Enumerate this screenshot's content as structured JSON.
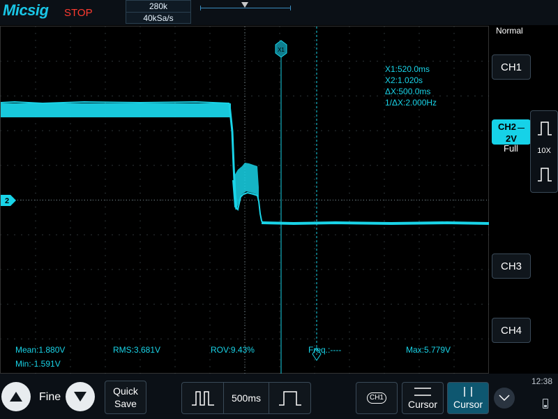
{
  "header": {
    "logo": "Micsig",
    "run_status": "STOP",
    "memory_depth": "280k",
    "sample_rate": "40kSa/s"
  },
  "cursor_readout": {
    "cursor1": "X1:520.0ms",
    "cursor2": "X2:1.020s",
    "delta": "ΔX:500.0ms",
    "inverse_delta": "1/ΔX:2.000Hz",
    "x1_tag": "X1"
  },
  "measurements": {
    "mean": "Mean:1.880V",
    "rms": "RMS:3.681V",
    "rov": "ROV:9.43%",
    "freq": "Freq.:----",
    "max": "Max:5.779V",
    "min": "Min:-1.591V"
  },
  "channel_marker": "2",
  "right_panel": {
    "trigger_mode": "Normal",
    "ch1": "CH1",
    "ch2": "CH2",
    "ch2_scale": "2V",
    "ch2_coupling": "Full",
    "probe_ratio": "10X",
    "ch3": "CH3",
    "ch4": "CH4"
  },
  "bottom_bar": {
    "fine_label": "Fine",
    "quick_save_line1": "Quick",
    "quick_save_line2": "Save",
    "timebase": "500ms",
    "ch1_badge": "CH1",
    "cursor_h_label": "Cursor",
    "cursor_v_label": "Cursor",
    "clock": "12:38"
  },
  "colors": {
    "trace": "#19d4e8",
    "grid": "#5a6a70",
    "accent": "#16d2e8",
    "stop": "#ff3b30"
  }
}
